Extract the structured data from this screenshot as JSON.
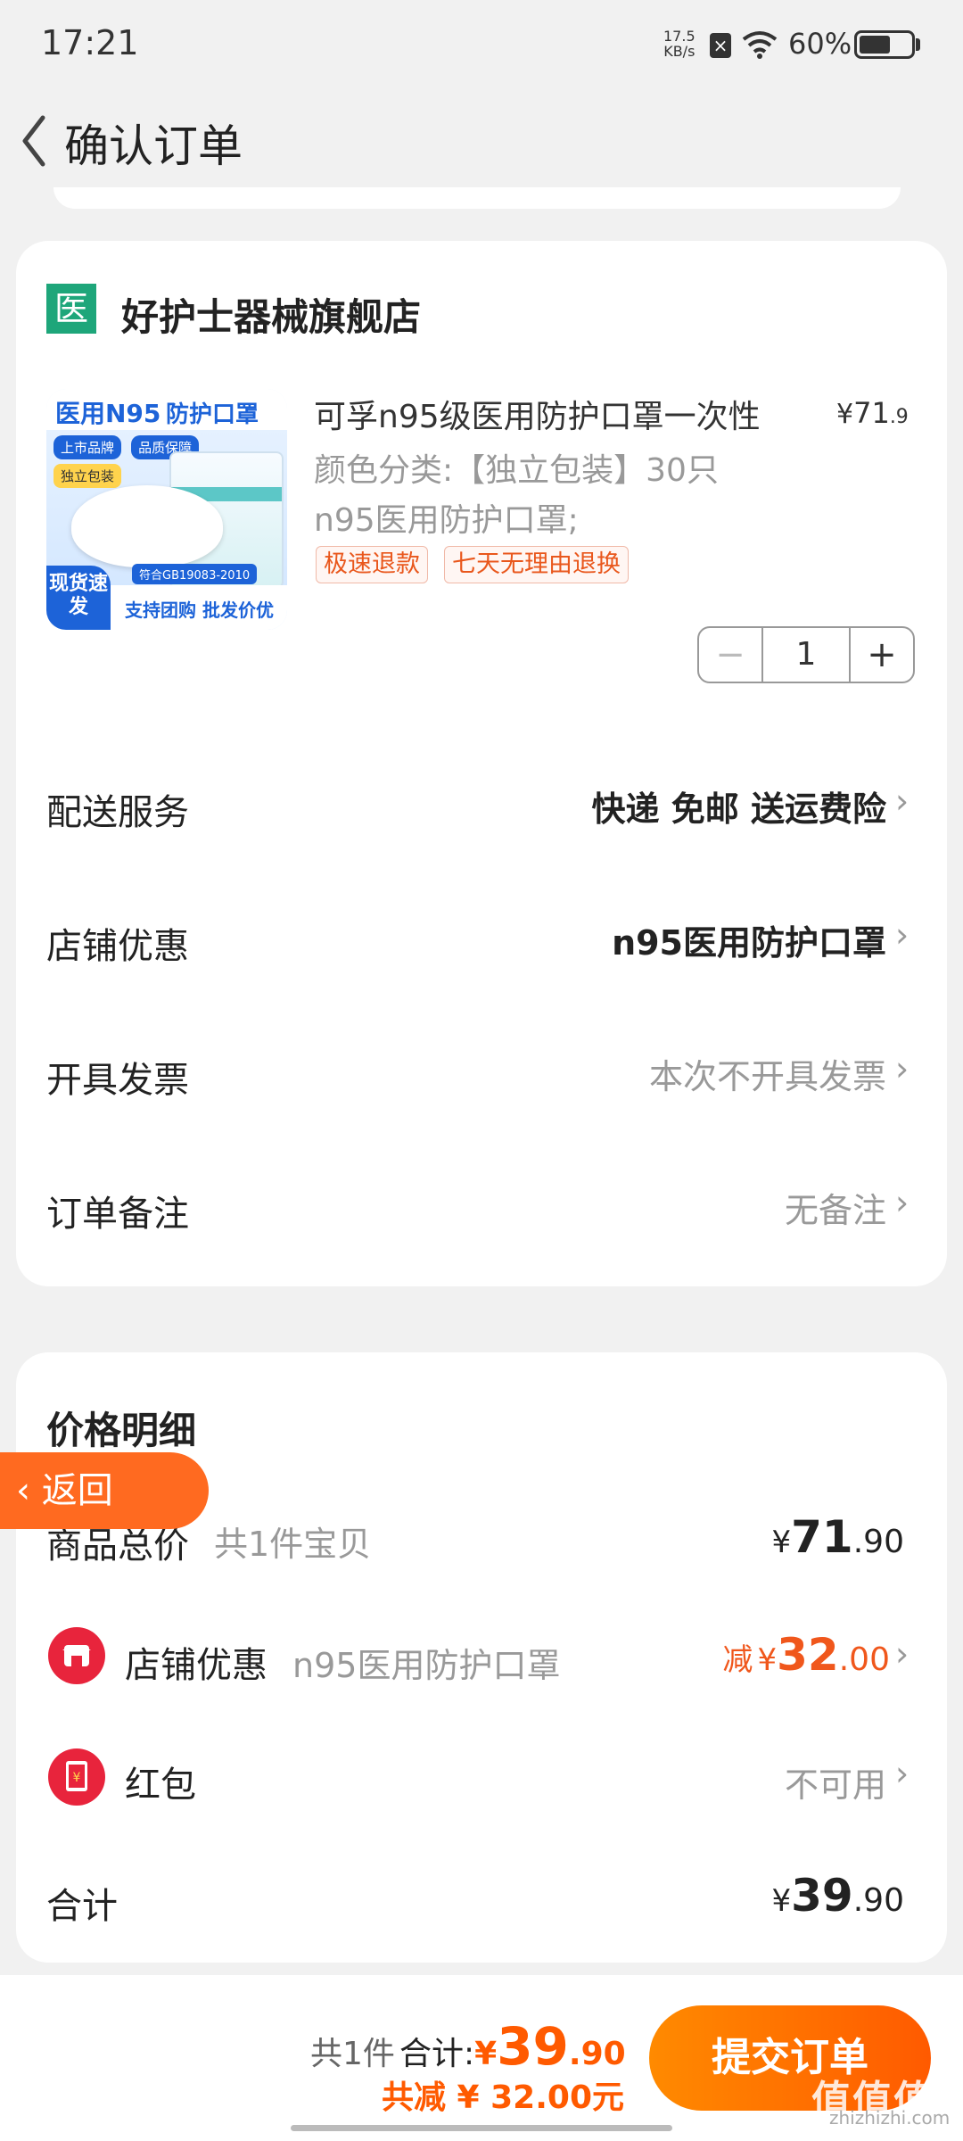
{
  "status_bar": {
    "time": "17:21",
    "speed_value": "17.5",
    "speed_unit": "KB/s",
    "battery": "60%",
    "battery_level": 0.6
  },
  "nav": {
    "title": "确认订单"
  },
  "store": {
    "icon_text": "医",
    "name": "好护士器械旗舰店"
  },
  "product": {
    "image_text": {
      "title_a": "医用N95",
      "title_b": "防护口罩",
      "tag1": "上市品牌",
      "tag2": "品质保障",
      "tag3": "独立包装",
      "badge": "现货速发",
      "standard": "符合GB19083-2010",
      "support": "支持团购 批发价优"
    },
    "title": "可孚n95级医用防护口罩一次性",
    "price_symbol": "¥",
    "price_int": "71",
    "price_dec": ".9",
    "sku_line1": "颜色分类:【独立包装】30只",
    "sku_line2": "n95医用防护口罩;",
    "tags": [
      "极速退款",
      "七天无理由退换"
    ],
    "quantity": "1",
    "minus": "−",
    "plus": "+"
  },
  "rows": [
    {
      "label": "配送服务",
      "value": "快递 免邮 送运费险",
      "style": "strong"
    },
    {
      "label": "店铺优惠",
      "value": "n95医用防护口罩",
      "style": "strong"
    },
    {
      "label": "开具发票",
      "value": "本次不开具发票",
      "style": "muted"
    },
    {
      "label": "订单备注",
      "value": "无备注",
      "style": "muted"
    }
  ],
  "price_detail": {
    "title": "价格明细",
    "total": {
      "label": "商品总价",
      "sub": "共1件宝贝",
      "symbol": "¥",
      "int": "71",
      "dec": ".90"
    },
    "discount": {
      "label": "店铺优惠",
      "sub": "n95医用防护口罩",
      "prefix": "减",
      "symbol": "¥",
      "int": "32",
      "dec": ".00"
    },
    "red_packet": {
      "label": "红包",
      "value": "不可用"
    },
    "sum": {
      "label": "合计",
      "symbol": "¥",
      "int": "39",
      "dec": ".90"
    }
  },
  "floating_back": {
    "label": "返回"
  },
  "bottom": {
    "count": "共1件",
    "total_label": "合计:",
    "symbol": "¥",
    "int": "39",
    "dec": ".90",
    "saved": "共减 ¥ 32.00元",
    "submit": "提交订单"
  },
  "watermark": {
    "main": "值值值",
    "sub": "zhizhizhi.com"
  },
  "colors": {
    "accent": "#ff5a00",
    "discount": "#f0571c",
    "store_green": "#1ea67a",
    "red": "#e8243c"
  },
  "icons": [
    "back-arrow-icon",
    "wifi-icon",
    "chevron-right-icon",
    "shop-icon",
    "red-packet-icon"
  ]
}
